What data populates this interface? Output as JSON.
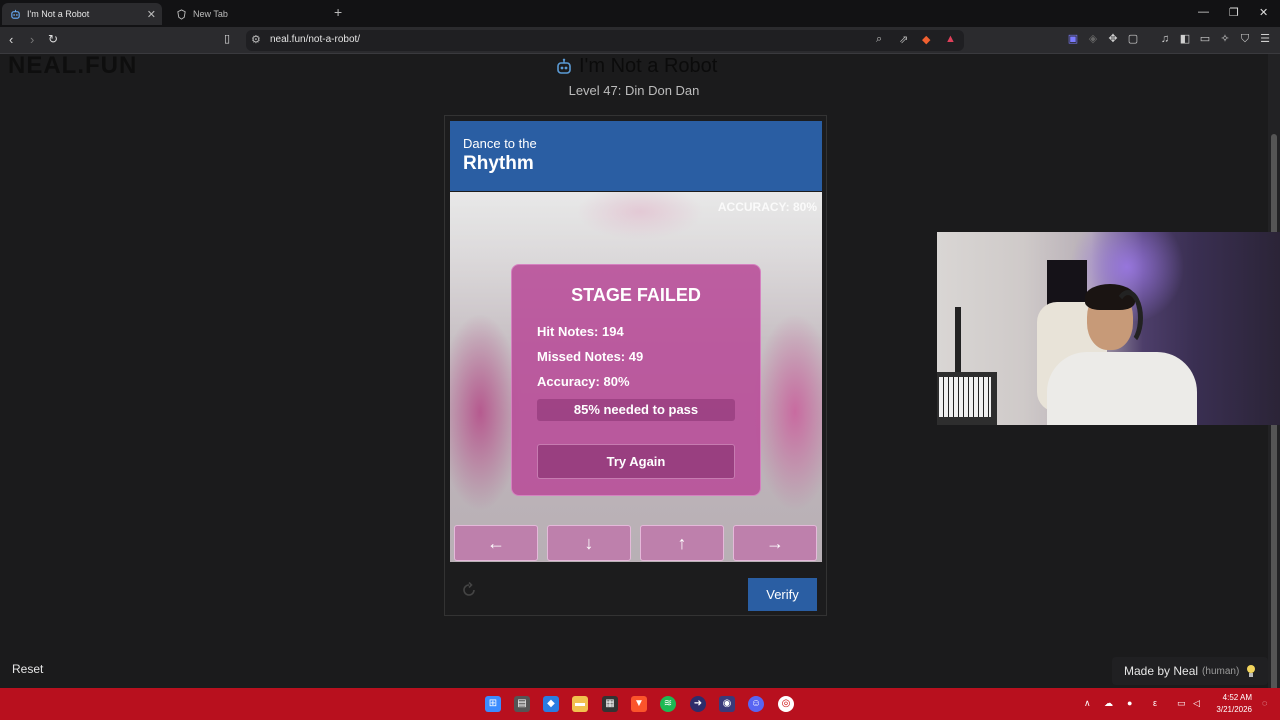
{
  "browser": {
    "tabs": [
      {
        "title": "I'm Not a Robot",
        "active": true
      },
      {
        "title": "New Tab",
        "active": false
      }
    ],
    "url": "neal.fun/not-a-robot/"
  },
  "site": {
    "logo": "NEAL.FUN",
    "title": "I'm Not a Robot",
    "level": "Level 47: Din Don Dan"
  },
  "captcha": {
    "header_sub": "Dance to the",
    "header_main": "Rhythm",
    "accuracy_top": "ACCURACY: 80%",
    "result": {
      "title": "STAGE FAILED",
      "hit_notes": "Hit Notes: 194",
      "missed_notes": "Missed Notes: 49",
      "accuracy": "Accuracy: 80%",
      "needed": "85% needed to pass",
      "try_again": "Try Again"
    },
    "arrows": [
      "←",
      "↓",
      "↑",
      "→"
    ],
    "verify": "Verify"
  },
  "footer": {
    "reset": "Reset",
    "made_by": "Made by Neal",
    "human": "(human)"
  },
  "taskbar": {
    "time": "4:52 AM",
    "date": "3/21/2026",
    "accent": "#b8101e"
  }
}
